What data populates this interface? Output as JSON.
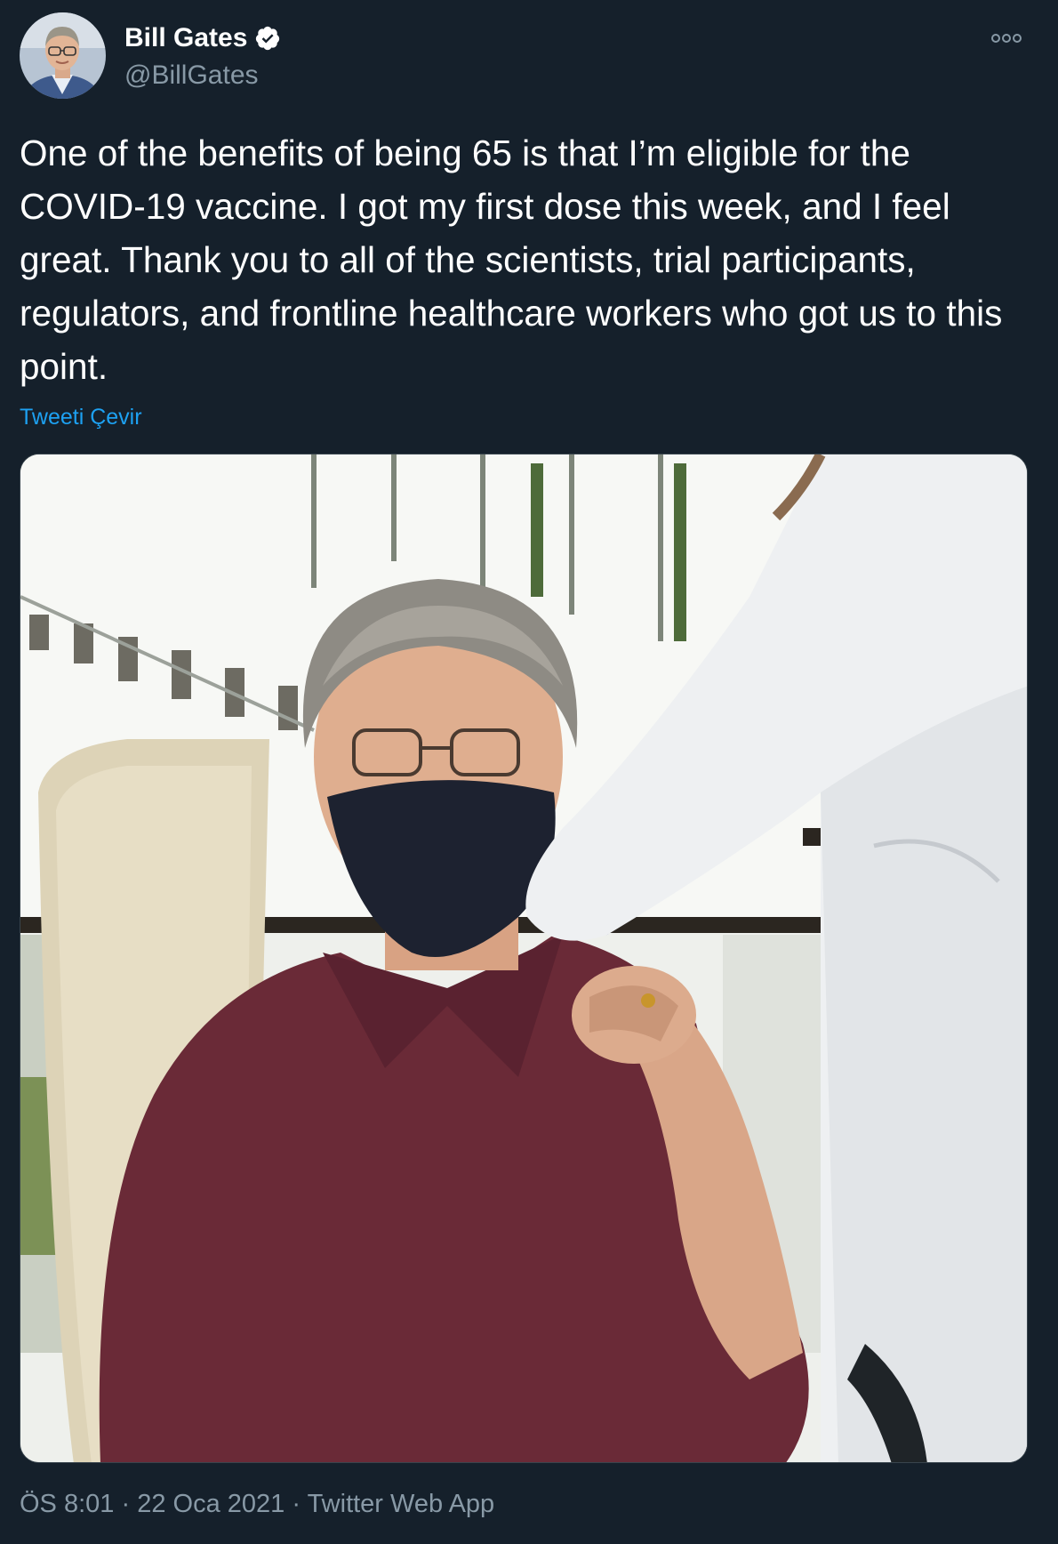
{
  "author": {
    "name": "Bill Gates",
    "handle": "@BillGates",
    "verified": true,
    "avatar_icon": "profile-avatar"
  },
  "tweet": {
    "text": "One of the benefits of being 65 is that I’m eligible for the COVID-19 vaccine. I got my first dose this week, and I feel great. Thank you to all of the scientists, trial participants, regulators, and frontline healthcare workers who got us to this point.",
    "translate_label": "Tweeti Çevir",
    "media_icon": "photo-vaccination"
  },
  "meta": {
    "time": "ÖS 8:01",
    "date": "22 Oca 2021",
    "source": "Twitter Web App",
    "separator": "·"
  },
  "colors": {
    "background": "#15202b",
    "text": "#ffffff",
    "secondary": "#8899a6",
    "accent": "#1da1f2"
  },
  "icons": {
    "verified": "verified-badge-icon",
    "more": "more-options-icon"
  }
}
